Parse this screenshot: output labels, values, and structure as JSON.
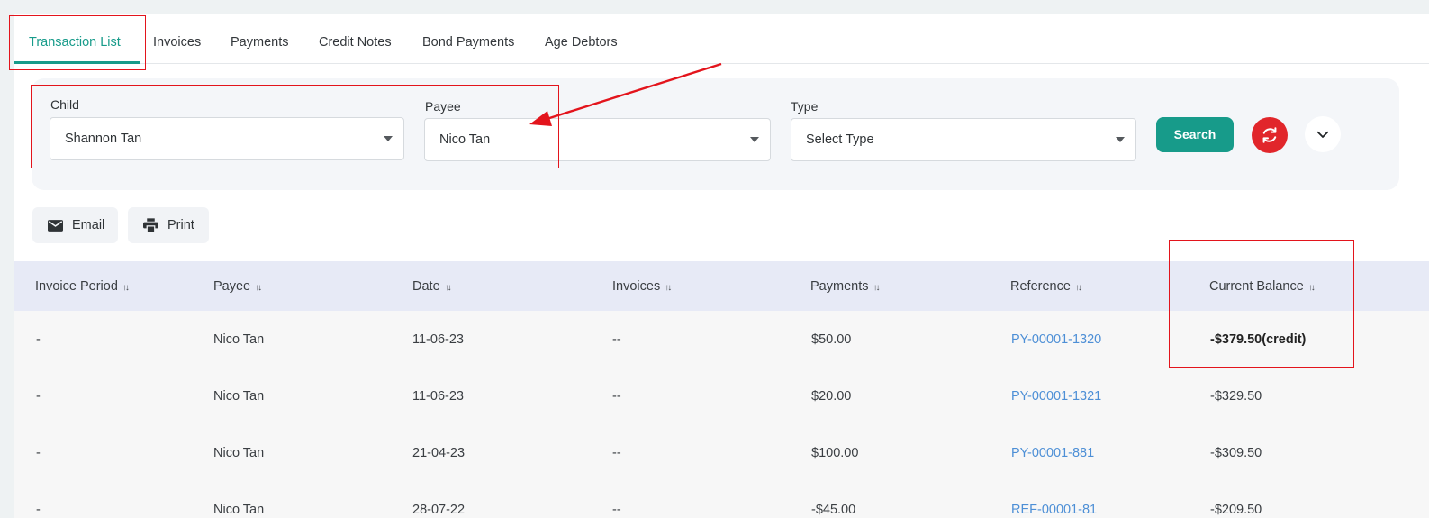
{
  "tabs": [
    {
      "label": "Transaction List",
      "active": true
    },
    {
      "label": "Invoices"
    },
    {
      "label": "Payments"
    },
    {
      "label": "Credit Notes"
    },
    {
      "label": "Bond Payments"
    },
    {
      "label": "Age Debtors"
    }
  ],
  "filters": {
    "child": {
      "label": "Child",
      "value": "Shannon Tan"
    },
    "payee": {
      "label": "Payee",
      "value": "Nico Tan"
    },
    "type": {
      "label": "Type",
      "value": "Select Type"
    },
    "search_label": "Search"
  },
  "actions": {
    "email_label": "Email",
    "print_label": "Print"
  },
  "table": {
    "headers": [
      "Invoice Period",
      "Payee",
      "Date",
      "Invoices",
      "Payments",
      "Reference",
      "Current Balance"
    ],
    "rows": [
      [
        "-",
        "Nico Tan",
        "11-06-23",
        "--",
        "$50.00",
        "PY-00001-1320",
        "-$379.50(credit)"
      ],
      [
        "-",
        "Nico Tan",
        "11-06-23",
        "--",
        "$20.00",
        "PY-00001-1321",
        "-$329.50"
      ],
      [
        "-",
        "Nico Tan",
        "21-04-23",
        "--",
        "$100.00",
        "PY-00001-881",
        "-$309.50"
      ],
      [
        "-",
        "Nico Tan",
        "28-07-22",
        "--",
        "-$45.00",
        "REF-00001-81",
        "-$209.50"
      ]
    ]
  },
  "colors": {
    "accent": "#179b8a",
    "reset": "#e1262b",
    "link": "#4d8fd6",
    "annotation": "#e3141c"
  }
}
